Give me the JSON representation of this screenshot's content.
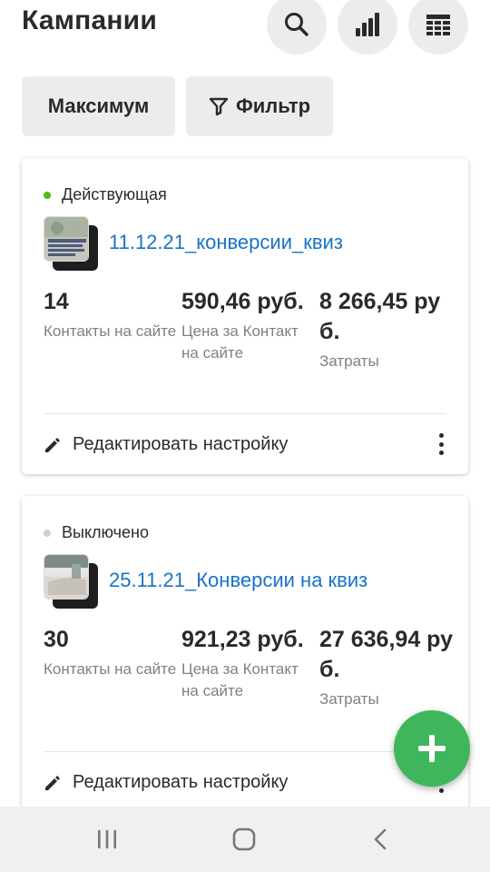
{
  "header": {
    "title": "Кампании",
    "buttons": [
      {
        "icon": "search-icon"
      },
      {
        "icon": "bar-chart-icon"
      },
      {
        "icon": "table-icon"
      }
    ]
  },
  "chips": {
    "maximum_label": "Максимум",
    "filter_label": "Фильтр",
    "filter_icon": "filter-icon"
  },
  "campaigns": [
    {
      "status": "Действующая",
      "status_color": "#4cbb17",
      "name": "11.12.21_конверсии_квиз",
      "metrics": [
        {
          "value": "14",
          "label": "Контакты на сайте"
        },
        {
          "value": "590,46 руб.",
          "label": "Цена за Контакт на сайте"
        },
        {
          "value": "8 266,45 руб.",
          "label": "Затраты"
        }
      ],
      "edit_label": "Редактировать настройку"
    },
    {
      "status": "Выключено",
      "status_color": "#d0d0d0",
      "name": "25.11.21_Конверсии на квиз",
      "metrics": [
        {
          "value": "30",
          "label": "Контакты на сайте"
        },
        {
          "value": "921,23 руб.",
          "label": "Цена за Контакт на сайте"
        },
        {
          "value": "27 636,94 руб.",
          "label": "Затраты"
        }
      ],
      "edit_label": "Редактировать настройку"
    }
  ],
  "fab": {
    "icon": "plus-icon",
    "color": "#3fb65b"
  },
  "accent_link_color": "#1a73c8",
  "system_nav": {
    "recent": "recent-apps-icon",
    "home": "home-icon",
    "back": "back-icon"
  }
}
